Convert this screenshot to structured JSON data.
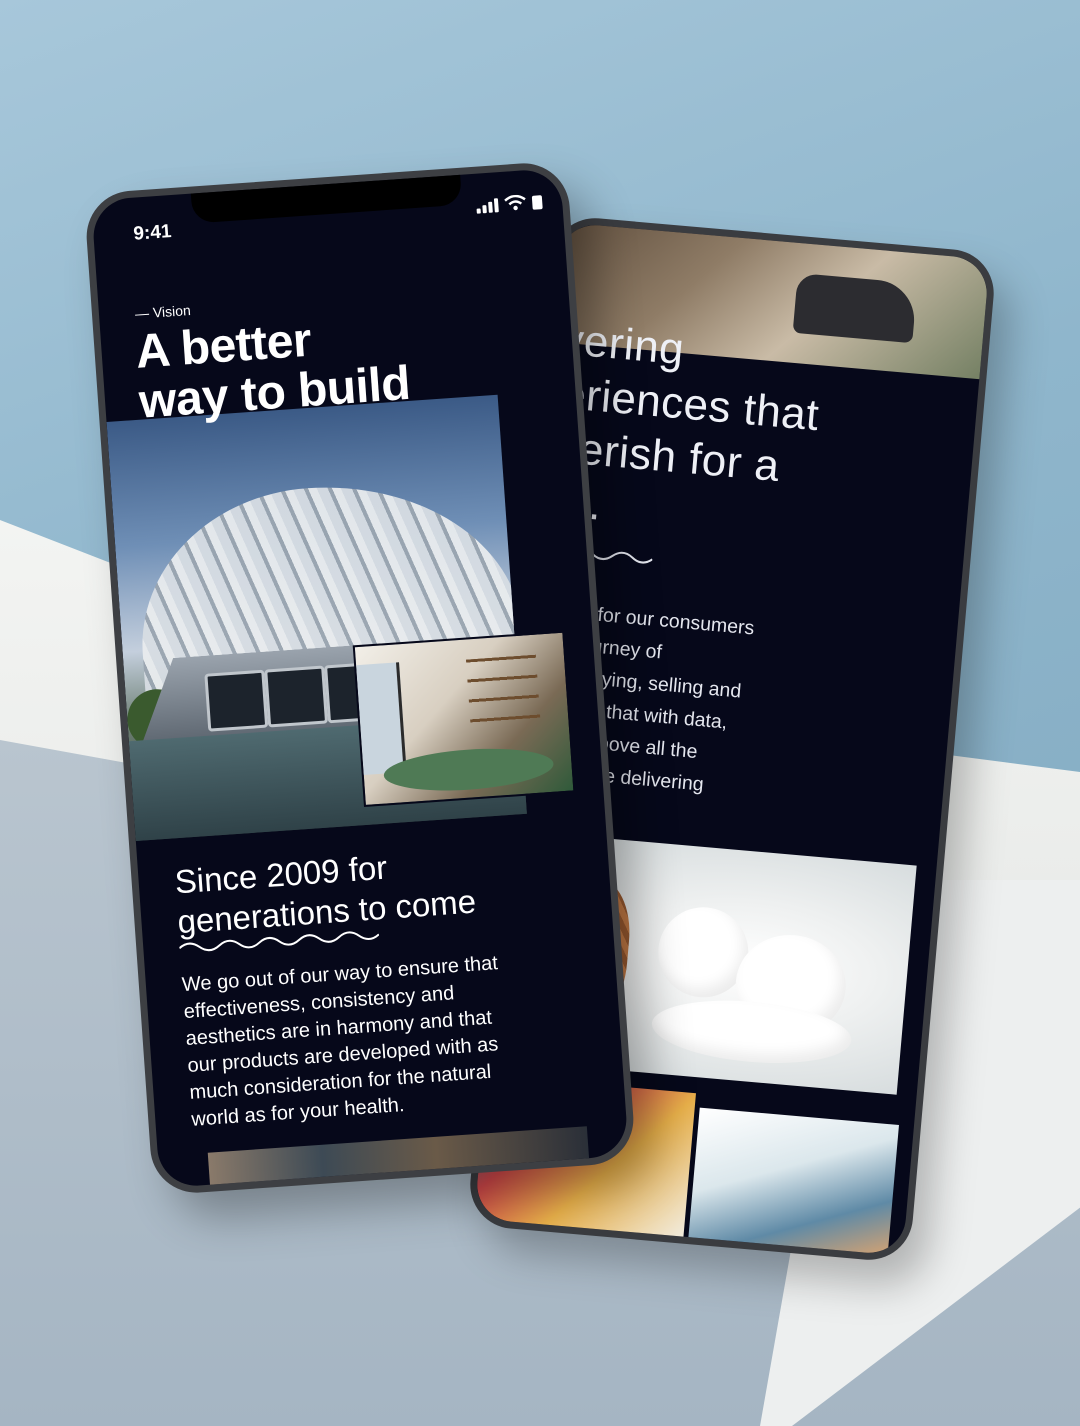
{
  "status_bar": {
    "time": "9:41"
  },
  "front": {
    "eyebrow": "— Vision",
    "hero_title": "A better\nway to build",
    "sub_title": "Since 2009 for\ngenerations to come",
    "body": "We go out of our way to ensure that\neffectiveness, consistency and\naesthetics are in harmony and that\nour products are developed with as\nmuch consideration for the natural\nworld as for your health."
  },
  "back": {
    "headline": "livering\nperiences that\n cherish for a\nme.",
    "body": "st choice for our consumers\n in their journey of\nrenting, buying, selling and\nme. We do that with data,\nlogy, and above all the\npeople, while delivering\nreholders."
  },
  "icons": [
    "signal-icon",
    "wifi-icon",
    "battery-icon",
    "wave-divider-icon"
  ],
  "colors": {
    "phone_bg": "#06081a",
    "frame": "#3d3f43",
    "text": "#ffffff"
  }
}
